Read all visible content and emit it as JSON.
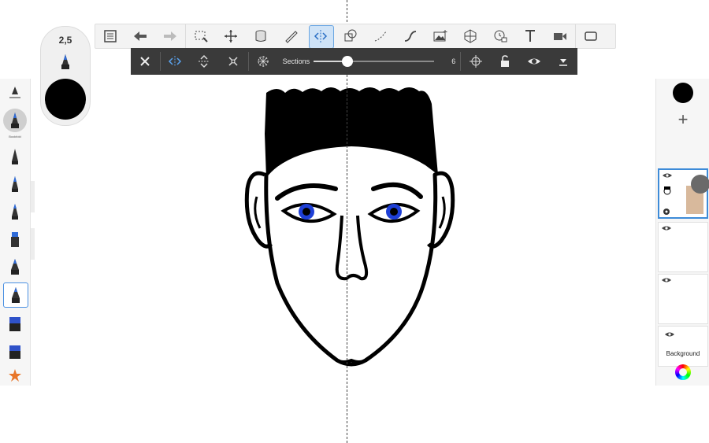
{
  "brush": {
    "size": "2,5",
    "color": "#000000",
    "type_label": "Bookfold"
  },
  "toolbar": {
    "tools": [
      "layers-list",
      "undo",
      "redo",
      "selection",
      "transform",
      "fill-bucket",
      "ruler",
      "symmetry",
      "shapes",
      "perspective-curve",
      "stroke",
      "image",
      "perspective-grid",
      "time-lapse",
      "text",
      "video",
      "fullscreen"
    ],
    "active_tool": "symmetry"
  },
  "symmetry": {
    "sections_label": "Sections",
    "sections_value": "6",
    "slider_fraction": 0.28
  },
  "layers": {
    "background_label": "Background",
    "current_color": "#000000"
  },
  "colors": {
    "accent": "#3d8bd8",
    "symbar_bg": "#3a3a3a",
    "iris": "#1e3fd6"
  }
}
